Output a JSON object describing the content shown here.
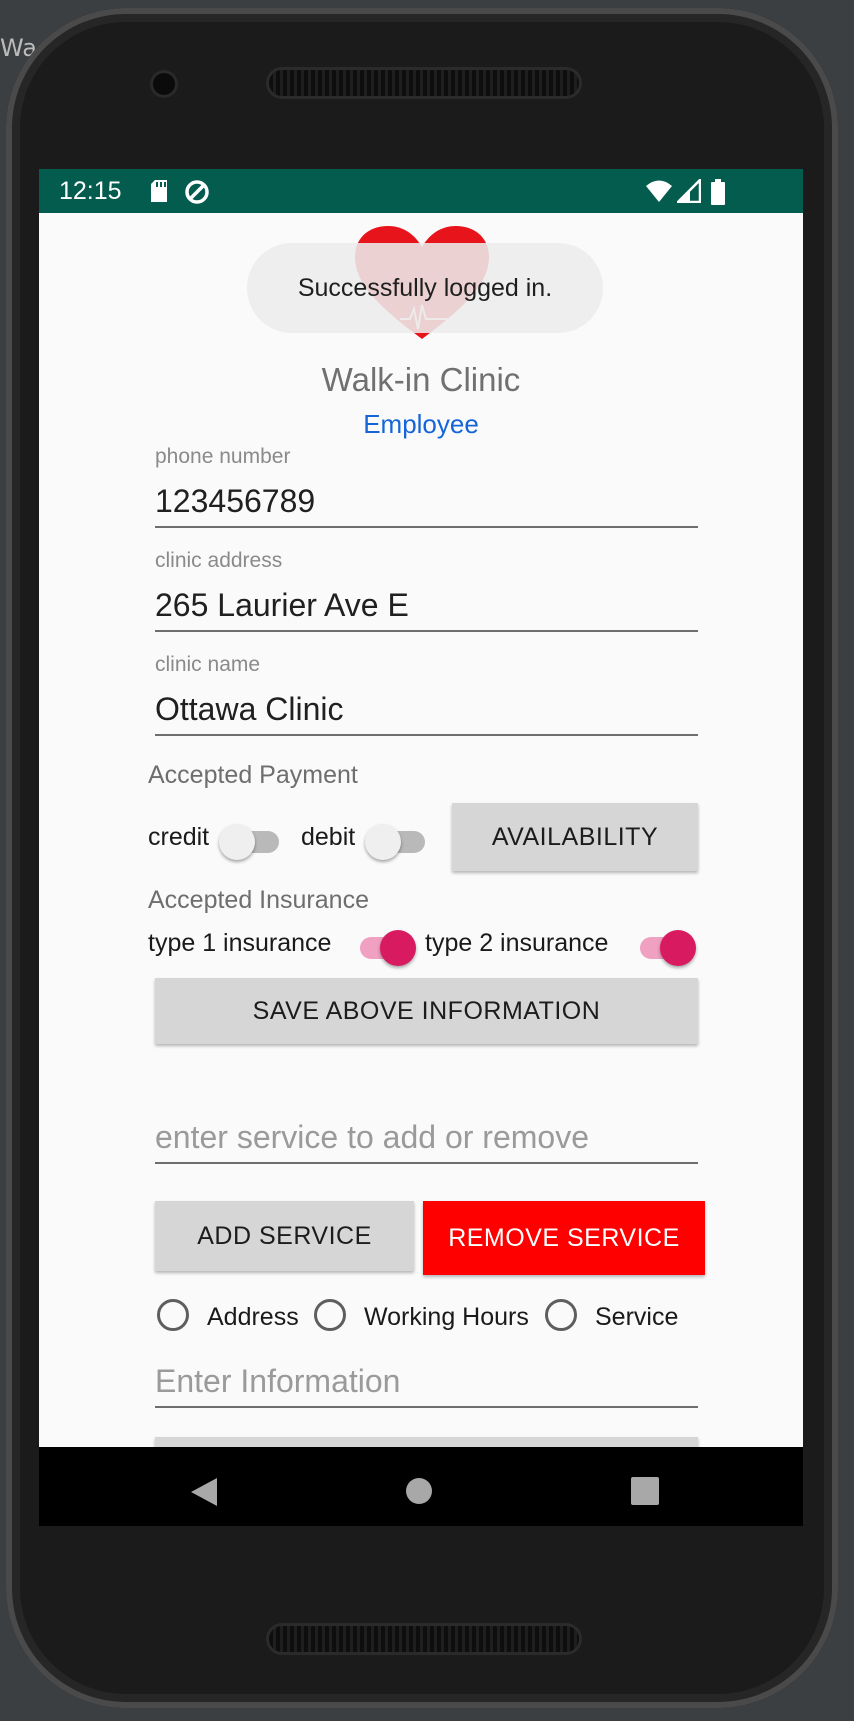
{
  "background": {
    "ide_fragment": "Wa"
  },
  "status_bar": {
    "time": "12:15",
    "icons": [
      "sd-card-icon",
      "data-saver-icon",
      "wifi-icon",
      "cell-signal-icon",
      "battery-icon"
    ],
    "color": "#035c4d"
  },
  "header": {
    "logo_icon": "heart-ecg-logo-icon",
    "app_title": "Walk-in Clinic",
    "role": "Employee",
    "role_color": "#1565d8"
  },
  "toast": {
    "message": "Successfully logged in."
  },
  "form": {
    "phone": {
      "label": "phone number",
      "value": "123456789"
    },
    "address": {
      "label": "clinic address",
      "value": "265 Laurier Ave E"
    },
    "name": {
      "label": "clinic name",
      "value": "Ottawa Clinic"
    }
  },
  "payment": {
    "heading": "Accepted Payment",
    "credit": {
      "label": "credit",
      "on": false
    },
    "debit": {
      "label": "debit",
      "on": false
    },
    "availability_button": "AVAILABILITY"
  },
  "insurance": {
    "heading": "Accepted Insurance",
    "type1": {
      "label": "type 1 insurance",
      "on": true
    },
    "type2": {
      "label": "type 2 insurance",
      "on": true
    },
    "accent_color": "#d81b60"
  },
  "save_button": "SAVE ABOVE INFORMATION",
  "service": {
    "placeholder": "enter service to add or remove",
    "add_button": "ADD SERVICE",
    "remove_button": "REMOVE SERVICE",
    "remove_color": "#ff0000"
  },
  "options": {
    "address": "Address",
    "working_hours": "Working Hours",
    "service": "Service"
  },
  "info": {
    "placeholder": "Enter Information"
  },
  "nav": {
    "icons": [
      "back-icon",
      "home-icon",
      "recents-icon"
    ]
  }
}
